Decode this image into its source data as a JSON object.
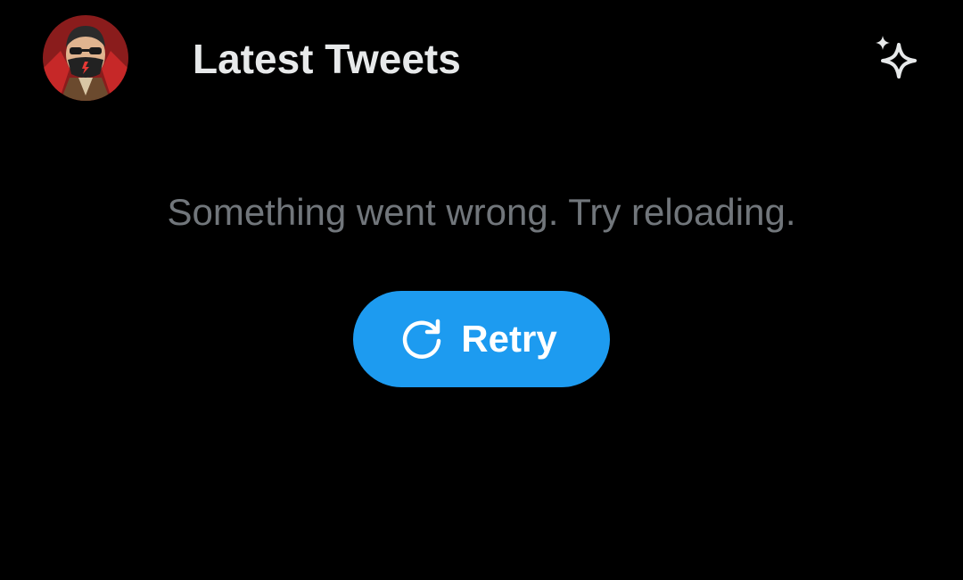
{
  "header": {
    "title": "Latest Tweets",
    "avatar_icon": "user-avatar",
    "sparkle_icon": "sparkle-icon"
  },
  "error": {
    "message": "Something went wrong. Try reloading."
  },
  "retry": {
    "label": "Retry",
    "icon": "refresh-icon"
  },
  "colors": {
    "background": "#000000",
    "title": "#e7e9ea",
    "muted_text": "#71767b",
    "accent": "#1d9bf0",
    "button_text": "#ffffff"
  }
}
